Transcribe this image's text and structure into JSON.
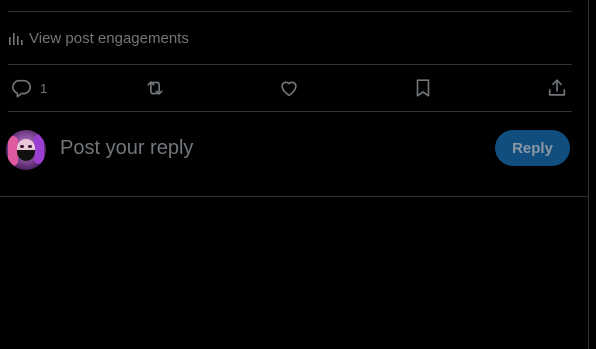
{
  "post": {
    "engagements_label": "View post engagements",
    "engagements_icon": "bar-chart-icon"
  },
  "actions": {
    "reply": {
      "icon": "reply-bubble-icon",
      "count": "1"
    },
    "repost": {
      "icon": "repost-icon",
      "count": ""
    },
    "like": {
      "icon": "heart-icon",
      "count": ""
    },
    "bookmark": {
      "icon": "bookmark-icon",
      "count": ""
    },
    "share": {
      "icon": "share-icon"
    }
  },
  "composer": {
    "placeholder": "Post your reply",
    "button_label": "Reply"
  },
  "colors": {
    "background": "#000000",
    "divider": "#2f3336",
    "muted_text": "#71767b",
    "button_bg": "#0f4e7e",
    "button_text": "#8b98a5"
  }
}
